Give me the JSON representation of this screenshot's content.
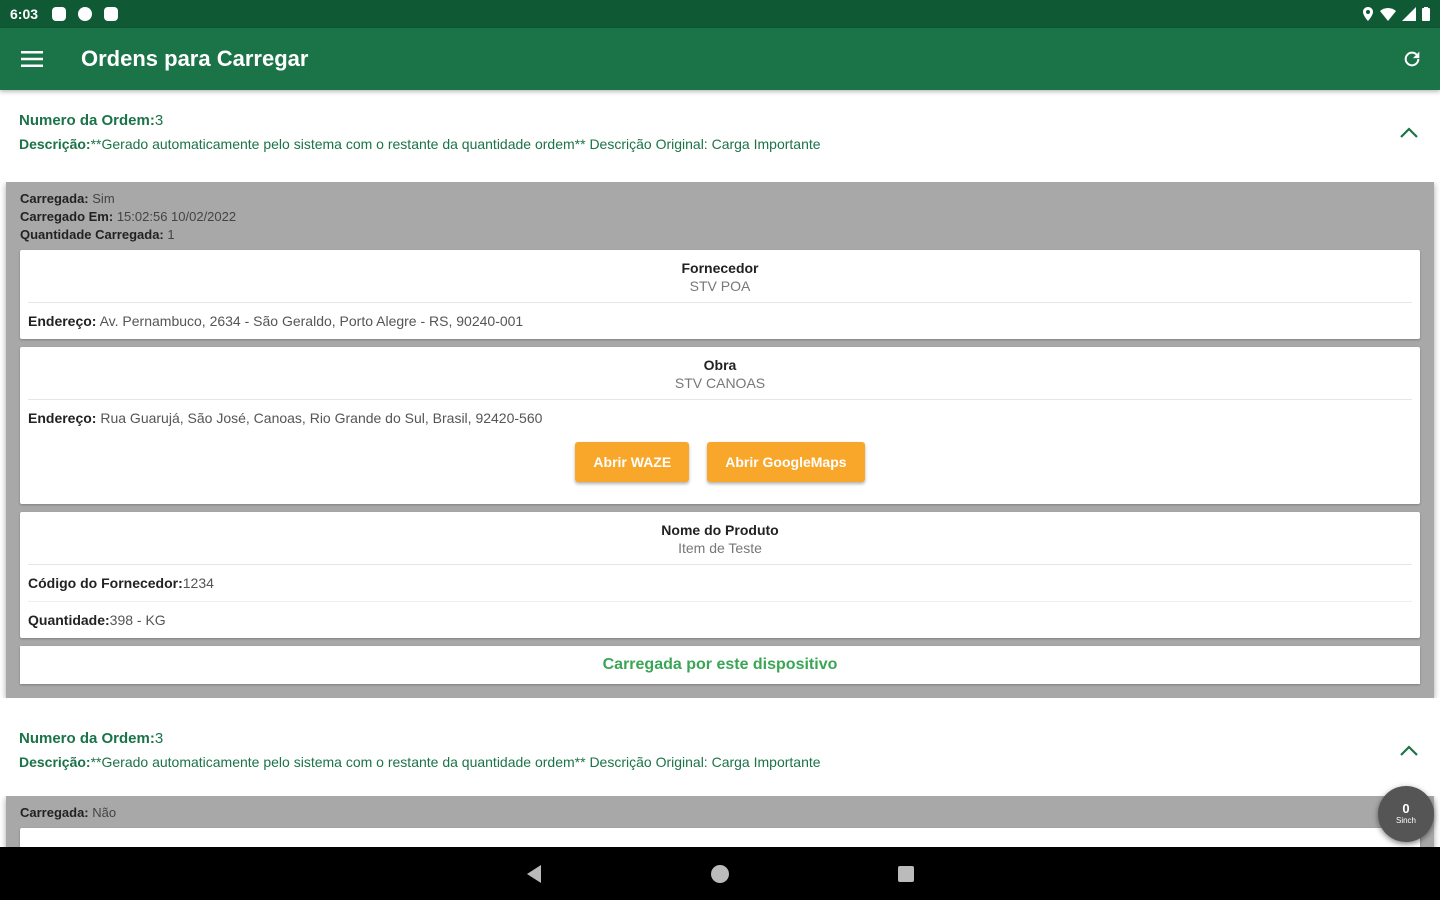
{
  "status_bar": {
    "time": "6:03"
  },
  "app_bar": {
    "title": "Ordens para Carregar"
  },
  "orders": [
    {
      "number_label": "Numero da Ordem:",
      "number_value": "3",
      "desc_label": "Descrição:",
      "desc_value": "**Gerado automaticamente pelo sistema com o restante da quantidade ordem** Descrição Original: Carga Importante",
      "loaded_label": "Carregada:",
      "loaded_value": "Sim",
      "loaded_at_label": "Carregado Em:",
      "loaded_at_value": "15:02:56 10/02/2022",
      "qty_loaded_label": "Quantidade Carregada:",
      "qty_loaded_value": "1",
      "supplier": {
        "title": "Fornecedor",
        "name": "STV POA",
        "addr_label": "Endereço:",
        "addr_value": "Av. Pernambuco, 2634 - São Geraldo, Porto Alegre - RS, 90240-001"
      },
      "site": {
        "title": "Obra",
        "name": "STV CANOAS",
        "addr_label": "Endereço:",
        "addr_value": "Rua Guarujá, São José, Canoas, Rio Grande do Sul, Brasil, 92420-560",
        "waze_btn": "Abrir WAZE",
        "gmaps_btn": "Abrir GoogleMaps"
      },
      "product": {
        "title": "Nome do Produto",
        "name": "Item de Teste",
        "code_label": "Código do Fornecedor:",
        "code_value": "1234",
        "qty_label": "Quantidade:",
        "qty_value": "398 - KG"
      },
      "device_status": "Carregada por este dispositivo"
    },
    {
      "number_label": "Numero da Ordem:",
      "number_value": "3",
      "desc_label": "Descrição:",
      "desc_value": "**Gerado automaticamente pelo sistema com o restante da quantidade ordem** Descrição Original: Carga Importante",
      "loaded_label": "Carregada:",
      "loaded_value": "Não"
    }
  ],
  "fab": {
    "count": "0",
    "label": "Sinch"
  },
  "colors": {
    "status_bar": "#0f5a35",
    "app_bar": "#1b7348",
    "accent_orange": "#f9a72b",
    "success_green": "#3aa655",
    "panel_gray": "#a8a8a8"
  },
  "icons": {
    "menu": "hamburger-icon",
    "refresh": "refresh-icon",
    "collapse": "chevron-up-icon",
    "back": "back-triangle-icon",
    "home": "home-circle-icon",
    "recents": "recents-square-icon"
  }
}
